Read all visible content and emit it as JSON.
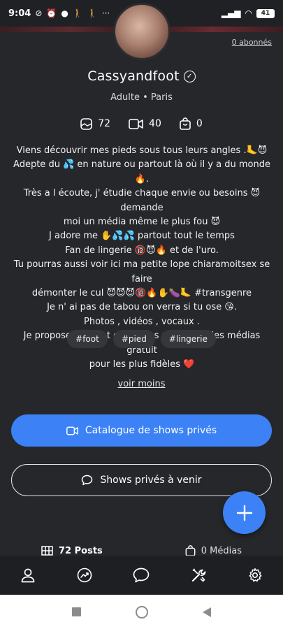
{
  "status_bar": {
    "time": "9:04",
    "icons": [
      "mute-icon",
      "alarm-icon",
      "chat-bubble-icon",
      "walk-icon",
      "walk-icon",
      "more-dots"
    ],
    "battery": "41"
  },
  "profile": {
    "abonnes_link": "0 abonnés",
    "username": "Cassyandfoot",
    "subtitle": "Adulte • Paris",
    "stats": {
      "photos": "72",
      "videos": "40",
      "products": "0"
    },
    "bio_lines": [
      "Viens découvrir mes pieds sous tous leurs angles .🦶😈",
      "Adepte du 💦 en nature ou partout là où il y a du monde 🔥.",
      "Très a l écoute, j' étudie chaque envie ou besoins 😈 demande",
      "moi un média même le plus fou 😈",
      "J adore me ✋💦💦 partout tout le temps",
      "Fan de lingerie 🔞😈🔥 et de l'uro.",
      "Tu pourras aussi voir ici ma petite lope chiaramoitsex se faire",
      "démonter le cul 😈😈😈🔞🔥✋🍆🦶 #transgenre",
      "Je n' ai pas de tabou on verra si tu ose 😘.",
      "Photos , vidéos , vocaux .",
      "Je propose souvent des codes promo ou des médias gratuit",
      "pour les plus fidèles ❤️"
    ],
    "tags": [
      "#foot",
      "#pied",
      "#lingerie"
    ],
    "voir_moins": "voir moins"
  },
  "actions": {
    "catalogue_label": "Catalogue de shows privés",
    "shows_label": "Shows privés à venir"
  },
  "content_tabs": {
    "posts": "72 Posts",
    "medias": "0 Médias"
  },
  "colors": {
    "background": "#26272b",
    "accent": "#3c82f6",
    "tag_bg": "#36373c",
    "nav_bg": "#1e1f22"
  }
}
